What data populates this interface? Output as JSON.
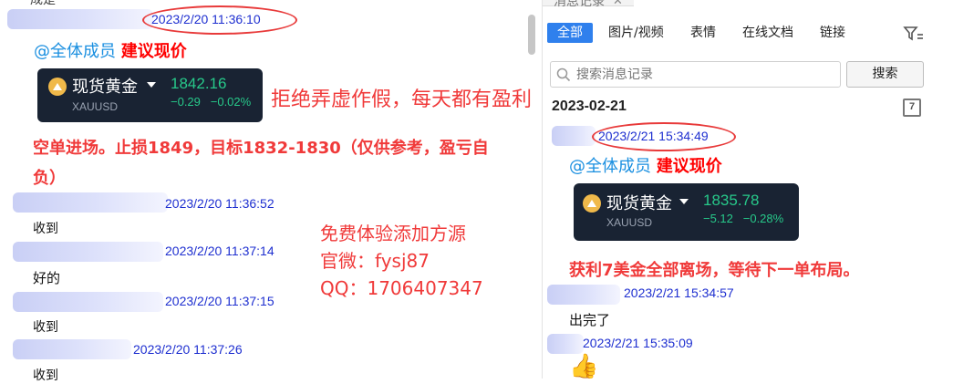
{
  "left": {
    "message1": {
      "timestamp": "2023/2/20 11:36:10",
      "mention": "@全体成员",
      "mention_bold": "建议现价",
      "card": {
        "name": "现货黄金",
        "symbol": "XAUUSD",
        "price": "1842.16",
        "change": "−0.29",
        "change_pct": "−0.02%"
      },
      "body": "空单进场。止损1849，目标1832-1830（仅供参考，盈亏自",
      "body_line2": "负）"
    },
    "message2": {
      "timestamp": "2023/2/20 11:36:52",
      "text": "收到"
    },
    "message3": {
      "timestamp": "2023/2/20 11:37:14",
      "text": "好的"
    },
    "message4": {
      "timestamp": "2023/2/20 11:37:15",
      "text": "收到"
    },
    "message5": {
      "timestamp": "2023/2/20 11:37:26",
      "text": "收到"
    },
    "top_partial": "成是"
  },
  "overlay": {
    "slogan": "拒绝弄虚作假，每天都有盈利",
    "promo_line1": "免费体验添加方源",
    "promo_line2": "官微：fysj87",
    "promo_line3": "QQ：1706407347"
  },
  "right_panel": {
    "header_partial": "消息记录",
    "tabs": [
      "全部",
      "图片/视频",
      "表情",
      "在线文档",
      "链接"
    ],
    "search": {
      "placeholder": "搜索消息记录",
      "button": "搜索"
    },
    "date_header": "2023-02-21",
    "calendar_label": "7",
    "message1": {
      "timestamp": "2023/2/21 15:34:49",
      "mention": "@全体成员",
      "mention_bold": "建议现价",
      "card": {
        "name": "现货黄金",
        "symbol": "XAUUSD",
        "price": "1835.78",
        "change": "−5.12",
        "change_pct": "−0.28%"
      },
      "body": "获利7美金全部离场，等待下一单布局。"
    },
    "message2": {
      "timestamp": "2023/2/21 15:34:57",
      "text": "出完了"
    },
    "message3": {
      "timestamp": "2023/2/21 15:35:09",
      "text": "👍"
    }
  },
  "colors": {
    "accent": "#2f80ed",
    "timestamp": "#1e2fd0",
    "red": "#ff0000",
    "card_bg": "#192333",
    "card_green": "#27c98a"
  }
}
